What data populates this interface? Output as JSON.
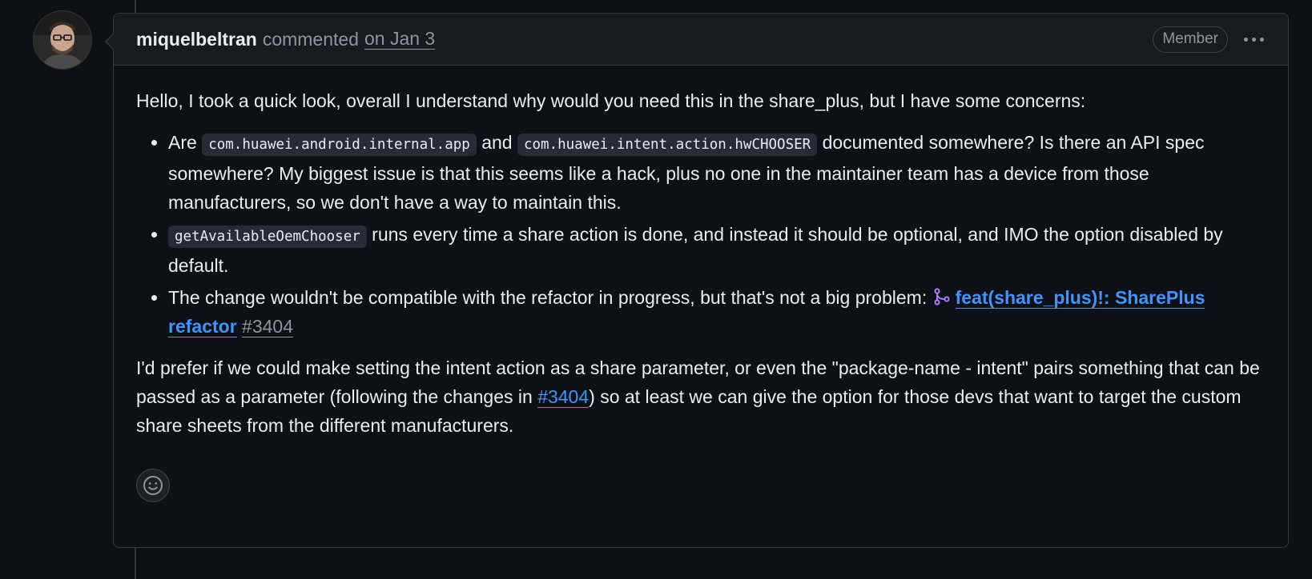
{
  "comment": {
    "author": "miquelbeltran",
    "action": "commented",
    "timestamp": "on Jan 3",
    "role_badge": "Member",
    "menu_icon": "kebab-horizontal-icon",
    "intro": "Hello, I took a quick look, overall I understand why would you need this in the share_plus, but I have some concerns:",
    "bullet1": {
      "t1": "Are ",
      "code1": "com.huawei.android.internal.app",
      "t2": " and ",
      "code2": "com.huawei.intent.action.hwCHOOSER",
      "t3": " documented somewhere? Is there an API spec somewhere? My biggest issue is that this seems like a hack, plus no one in the maintainer team has a device from those manufacturers, so we don't have a way to maintain this."
    },
    "bullet2": {
      "code": "getAvailableOemChooser",
      "t1": " runs every time a share action is done, and instead it should be optional, and IMO the option disabled by default."
    },
    "bullet3": {
      "t1": "The change wouldn't be compatible with the refactor in progress, but that's not a big problem: ",
      "pr_icon": "git-merge-icon",
      "pr_title": "feat(share_plus)!: SharePlus refactor",
      "pr_number": "#3404"
    },
    "closing": {
      "t1": "I'd prefer if we could make setting the intent action as a share parameter, or even the \"package-name - intent\" pairs something that can be passed as a parameter (following the changes in ",
      "link": "#3404",
      "t2": ") so at least we can give the option for those devs that want to target the custom share sheets from the different manufacturers."
    },
    "reaction_icon": "smiley-icon"
  },
  "colors": {
    "background": "#0d1117",
    "header_bg": "#161b22",
    "border": "#30363d",
    "text": "#e6edf3",
    "muted": "#8d96a0",
    "link": "#4493f8",
    "merged_purple": "#ab7df8"
  }
}
